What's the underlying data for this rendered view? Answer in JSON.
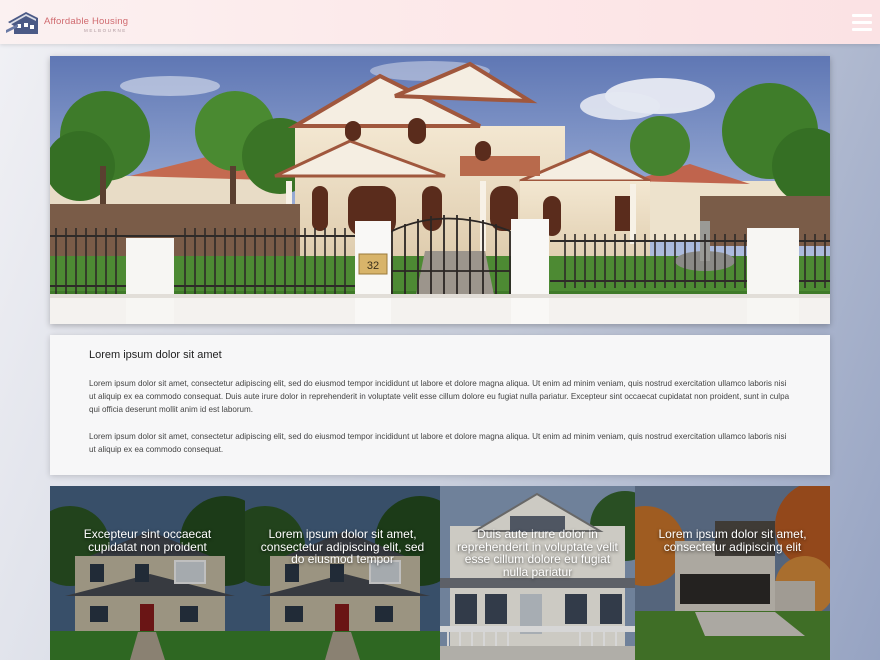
{
  "header": {
    "logo_title": "Affordable Housing",
    "logo_subtitle": "MELBOURNE",
    "menu_icon": "hamburger-menu-icon",
    "brand_color": "#d06a6f"
  },
  "hero": {
    "gate_number": "32"
  },
  "intro": {
    "heading": "Lorem ipsum dolor sit amet",
    "paragraph_1": "Lorem ipsum dolor sit amet, consectetur adipiscing elit, sed do eiusmod tempor incididunt ut labore et dolore magna aliqua. Ut enim ad minim veniam, quis nostrud exercitation ullamco laboris nisi ut aliquip ex ea commodo consequat. Duis aute irure dolor in reprehenderit in voluptate velit esse cillum dolore eu fugiat nulla pariatur. Excepteur sint occaecat cupidatat non proident, sunt in culpa qui officia deserunt mollit anim id est laborum.",
    "paragraph_2": "Lorem ipsum dolor sit amet, consectetur adipiscing elit, sed do eiusmod tempor incididunt ut labore et dolore magna aliqua. Ut enim ad minim veniam, quis nostrud exercitation ullamco laboris nisi ut aliquip ex ea commodo consequat."
  },
  "tiles": [
    {
      "caption": "Excepteur sint occaecat cupidatat non proident"
    },
    {
      "caption": "Lorem ipsum dolor sit amet, consectetur adipiscing elit, sed do eiusmod tempor"
    },
    {
      "caption": "Duis aute irure dolor in reprehenderit in voluptate velit esse cillum dolore eu fugiat nulla pariatur"
    },
    {
      "caption": "Lorem ipsum dolor sit amet, consectetur adipiscing elit"
    }
  ]
}
